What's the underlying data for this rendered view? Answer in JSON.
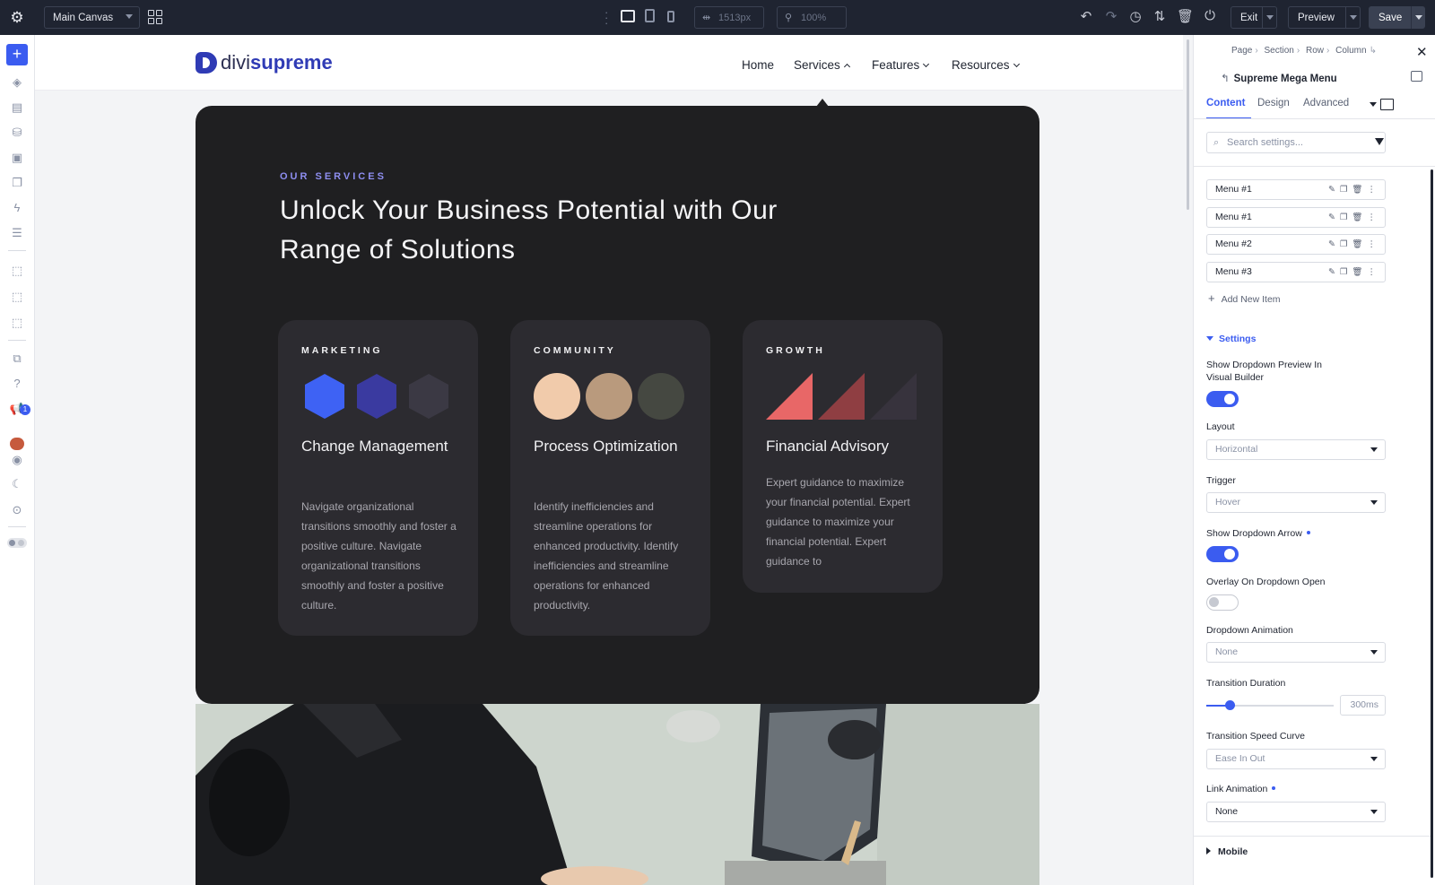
{
  "topbar": {
    "canvas_select": "Main Canvas",
    "width_value": "1513px",
    "zoom_value": "100%",
    "exit_label": "Exit",
    "preview_label": "Preview",
    "save_label": "Save",
    "icons": [
      "gear-icon",
      "grid-icon",
      "desktop-icon",
      "tablet-icon",
      "phone-icon",
      "width-icon",
      "zoom-icon",
      "undo-icon",
      "redo-icon",
      "history-icon",
      "sort-icon",
      "trash-icon",
      "power-icon"
    ]
  },
  "left_toolbar": {
    "notification_count": "1",
    "help_glyph": "?",
    "icons": [
      "add-icon",
      "layers-icon",
      "pages-icon",
      "database-icon",
      "settings-icon",
      "copy-icon",
      "lightning-icon",
      "layout-icon",
      "pointer-icon",
      "hand-icon",
      "theme-icon",
      "portability-icon",
      "help-icon",
      "announcement-icon",
      "emoji-icon",
      "cursor-icon",
      "moon-icon",
      "target-icon",
      "toggle-icon"
    ]
  },
  "site": {
    "logo_divi": "divi",
    "logo_supreme": "supreme",
    "nav": [
      "Home",
      "Services",
      "Features",
      "Resources"
    ],
    "mega": {
      "eyebrow": "OUR SERVICES",
      "headline": "Unlock Your Business Potential with Our Range of Solutions",
      "cards": [
        {
          "category": "MARKETING",
          "title": "Change Management",
          "body": "Navigate organizational transitions smoothly and foster a positive culture. Navigate organizational transitions smoothly and foster a positive culture.",
          "colors": [
            "#3e62f4",
            "#3a3aa0",
            "#3b3944"
          ]
        },
        {
          "category": "COMMUNITY",
          "title": "Process Optimization",
          "body": "Identify inefficiencies and streamline operations for enhanced productivity. Identify inefficiencies and streamline operations for enhanced productivity.",
          "colors": [
            "#f1cbab",
            "#b99a7d",
            "#454841"
          ]
        },
        {
          "category": "GROWTH",
          "title": "Financial Advisory",
          "body": "Expert guidance to maximize your financial potential. Expert guidance to maximize your financial potential. Expert guidance to",
          "colors": [
            "#e86767",
            "#8f3e42",
            "#37333d"
          ]
        }
      ]
    }
  },
  "panel": {
    "breadcrumb": [
      "Page",
      "Section",
      "Row",
      "Column"
    ],
    "module_title": "Supreme Mega Menu",
    "tabs": [
      "Content",
      "Design",
      "Advanced"
    ],
    "search_placeholder": "Search settings...",
    "menu_items": [
      "Menu #1",
      "Menu #1",
      "Menu #2",
      "Menu #3"
    ],
    "add_item_label": "Add New Item",
    "settings_label": "Settings",
    "show_preview_label": "Show Dropdown Preview In Visual Builder",
    "show_preview_on": true,
    "layout_label": "Layout",
    "layout_value": "Horizontal",
    "trigger_label": "Trigger",
    "trigger_value": "Hover",
    "arrow_label": "Show Dropdown Arrow",
    "arrow_on": true,
    "overlay_label": "Overlay On Dropdown Open",
    "overlay_on": false,
    "animation_label": "Dropdown Animation",
    "animation_value": "None",
    "duration_label": "Transition Duration",
    "duration_value": "300ms",
    "duration_fraction": 0.18,
    "curve_label": "Transition Speed Curve",
    "curve_value": "Ease In Out",
    "link_anim_label": "Link Animation",
    "link_anim_value": "None",
    "mobile_label": "Mobile",
    "accent": "#3b5cf0"
  }
}
